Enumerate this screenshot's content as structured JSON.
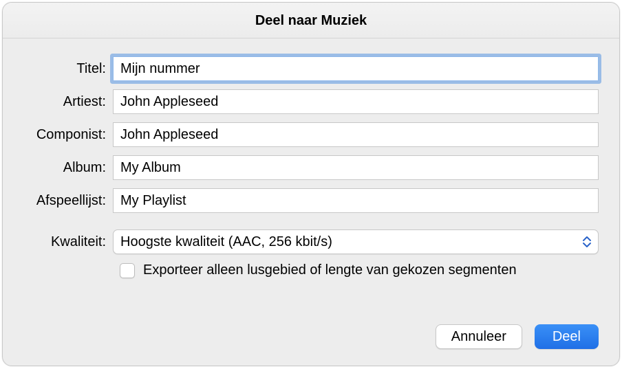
{
  "window": {
    "title": "Deel naar Muziek"
  },
  "labels": {
    "title": "Titel:",
    "artist": "Artiest:",
    "composer": "Componist:",
    "album": "Album:",
    "playlist": "Afspeellijst:",
    "quality": "Kwaliteit:"
  },
  "fields": {
    "title": "Mijn nummer",
    "artist": "John Appleseed",
    "composer": "John Appleseed",
    "album": "My Album",
    "playlist": "My Playlist"
  },
  "quality": {
    "selected": "Hoogste kwaliteit (AAC, 256 kbit/s)"
  },
  "checkbox": {
    "export_cycle_label": "Exporteer alleen lusgebied of lengte van gekozen segmenten",
    "checked": false
  },
  "buttons": {
    "cancel": "Annuleer",
    "share": "Deel"
  }
}
